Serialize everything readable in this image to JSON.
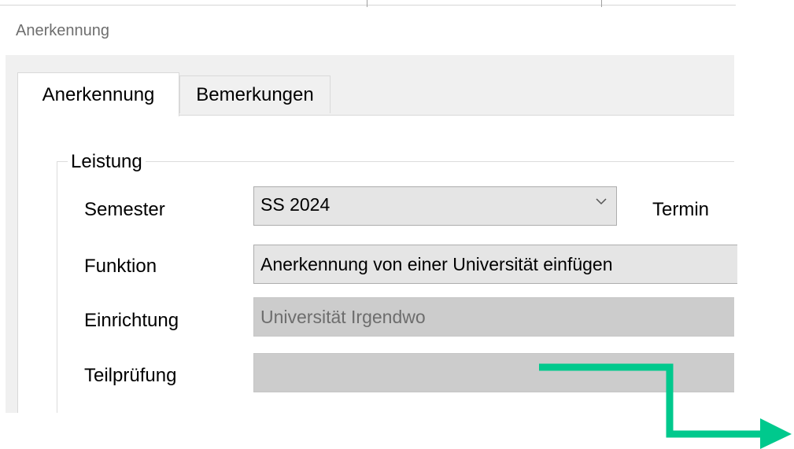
{
  "window": {
    "title": "Anerkennung"
  },
  "tabs": [
    {
      "label": "Anerkennung",
      "active": true
    },
    {
      "label": "Bemerkungen",
      "active": false
    }
  ],
  "group": {
    "legend": "Leistung"
  },
  "fields": {
    "semester": {
      "label": "Semester",
      "value": "SS 2024"
    },
    "termin": {
      "label": "Termin"
    },
    "funktion": {
      "label": "Funktion",
      "value": "Anerkennung von einer Universität einfügen"
    },
    "einrichtung": {
      "label": "Einrichtung",
      "value": "Universität Irgendwo"
    },
    "teilpruefung": {
      "label": "Teilprüfung",
      "value": ""
    }
  },
  "icons": {
    "dropdown": "chevron-down-icon",
    "annotation": "arrow-right-icon"
  },
  "colors": {
    "accent_arrow": "#00c98d",
    "dialog_background": "#f0f0f0",
    "disabled_field": "#cccccc",
    "combo_background": "#e5e5e5"
  }
}
